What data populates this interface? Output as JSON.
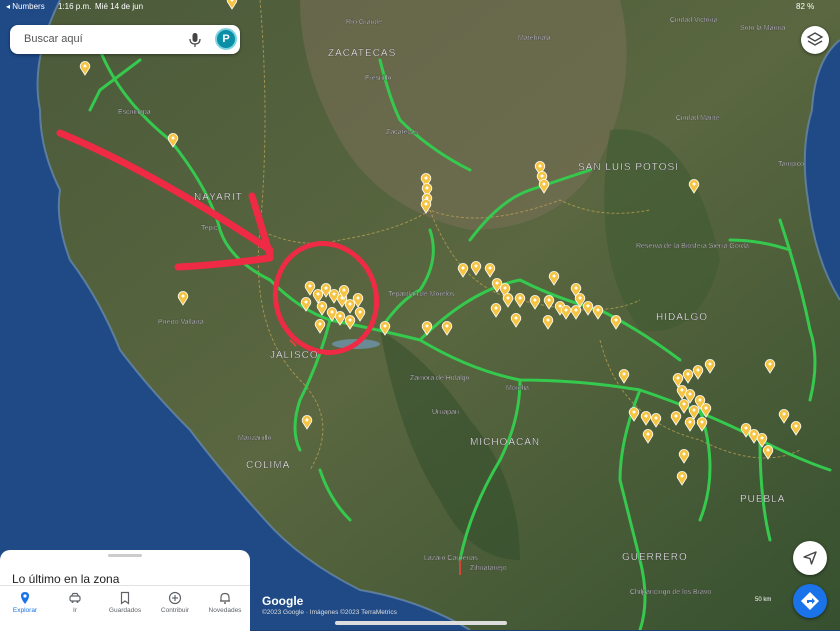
{
  "status_bar": {
    "left": "◂ Numbers",
    "time": "1:16 p.m.",
    "date": "Mié 14 de jun",
    "battery": "82 %"
  },
  "search": {
    "placeholder": "Buscar aquí",
    "avatar_letter": "P"
  },
  "map": {
    "labels": [
      {
        "text": "Río Grande",
        "key": "rg",
        "big": false
      },
      {
        "text": "ZACATECAS",
        "key": "zac",
        "big": true
      },
      {
        "text": "Fresnillo",
        "key": "fres",
        "big": false
      },
      {
        "text": "Matehuala",
        "key": "mat",
        "big": false
      },
      {
        "text": "Ciudad Victoria",
        "key": "cv",
        "big": false
      },
      {
        "text": "Soto la Marina",
        "key": "slm",
        "big": false
      },
      {
        "text": "Escuinapa",
        "key": "esc",
        "big": false
      },
      {
        "text": "Zacatecas",
        "key": "zacc",
        "big": false
      },
      {
        "text": "Ciudad Mante",
        "key": "cm",
        "big": false
      },
      {
        "text": "SAN LUIS POTOSÍ",
        "key": "slp",
        "big": true
      },
      {
        "text": "Tampico",
        "key": "tam",
        "big": false
      },
      {
        "text": "NAYARIT",
        "key": "nay",
        "big": true
      },
      {
        "text": "Tepic",
        "key": "tep",
        "big": false
      },
      {
        "text": "Reserva de la Biosfera Sierra Gorda",
        "key": "rb",
        "big": false
      },
      {
        "text": "Tepatitlán de Morelos",
        "key": "tpm",
        "big": false
      },
      {
        "text": "Puerto Vallarta",
        "key": "pv",
        "big": false
      },
      {
        "text": "HIDALGO",
        "key": "hid",
        "big": true
      },
      {
        "text": "JALISCO",
        "key": "jal",
        "big": true
      },
      {
        "text": "Zamora de Hidalgo",
        "key": "zam",
        "big": false
      },
      {
        "text": "Morelia",
        "key": "mor",
        "big": false
      },
      {
        "text": "Uruapan",
        "key": "uru",
        "big": false
      },
      {
        "text": "MICHOACÁN",
        "key": "mich",
        "big": true
      },
      {
        "text": "Manzanillo",
        "key": "man",
        "big": false
      },
      {
        "text": "COLIMA",
        "key": "col",
        "big": true
      },
      {
        "text": "PUEBLA",
        "key": "pue",
        "big": true
      },
      {
        "text": "Lázaro Cárdenas",
        "key": "lc",
        "big": false
      },
      {
        "text": "Zihuatanejo",
        "key": "zih",
        "big": false
      },
      {
        "text": "GUERRERO",
        "key": "gue",
        "big": true
      },
      {
        "text": "Chilpancingo de los Bravo",
        "key": "chil",
        "big": false
      }
    ],
    "annotation": {
      "type": "red arrow pointing to a red circled cluster of pins",
      "color": "#ee2a44"
    },
    "pin_color": "#f6c443",
    "traffic_color": "#35c94e"
  },
  "sheet": {
    "title": "Lo último en la zona"
  },
  "tabs": [
    {
      "label": "Explorar",
      "icon": "pin-icon",
      "active": true
    },
    {
      "label": "Ir",
      "icon": "car-icon",
      "active": false
    },
    {
      "label": "Guardados",
      "icon": "bookmark-icon",
      "active": false
    },
    {
      "label": "Contribuir",
      "icon": "plus-circle-icon",
      "active": false
    },
    {
      "label": "Novedades",
      "icon": "bell-icon",
      "active": false
    }
  ],
  "attribution": {
    "logo": "Google",
    "copyright": "©2023 Google · Imágenes ©2023 TerraMetrics"
  },
  "scale": {
    "label": "50 km"
  }
}
